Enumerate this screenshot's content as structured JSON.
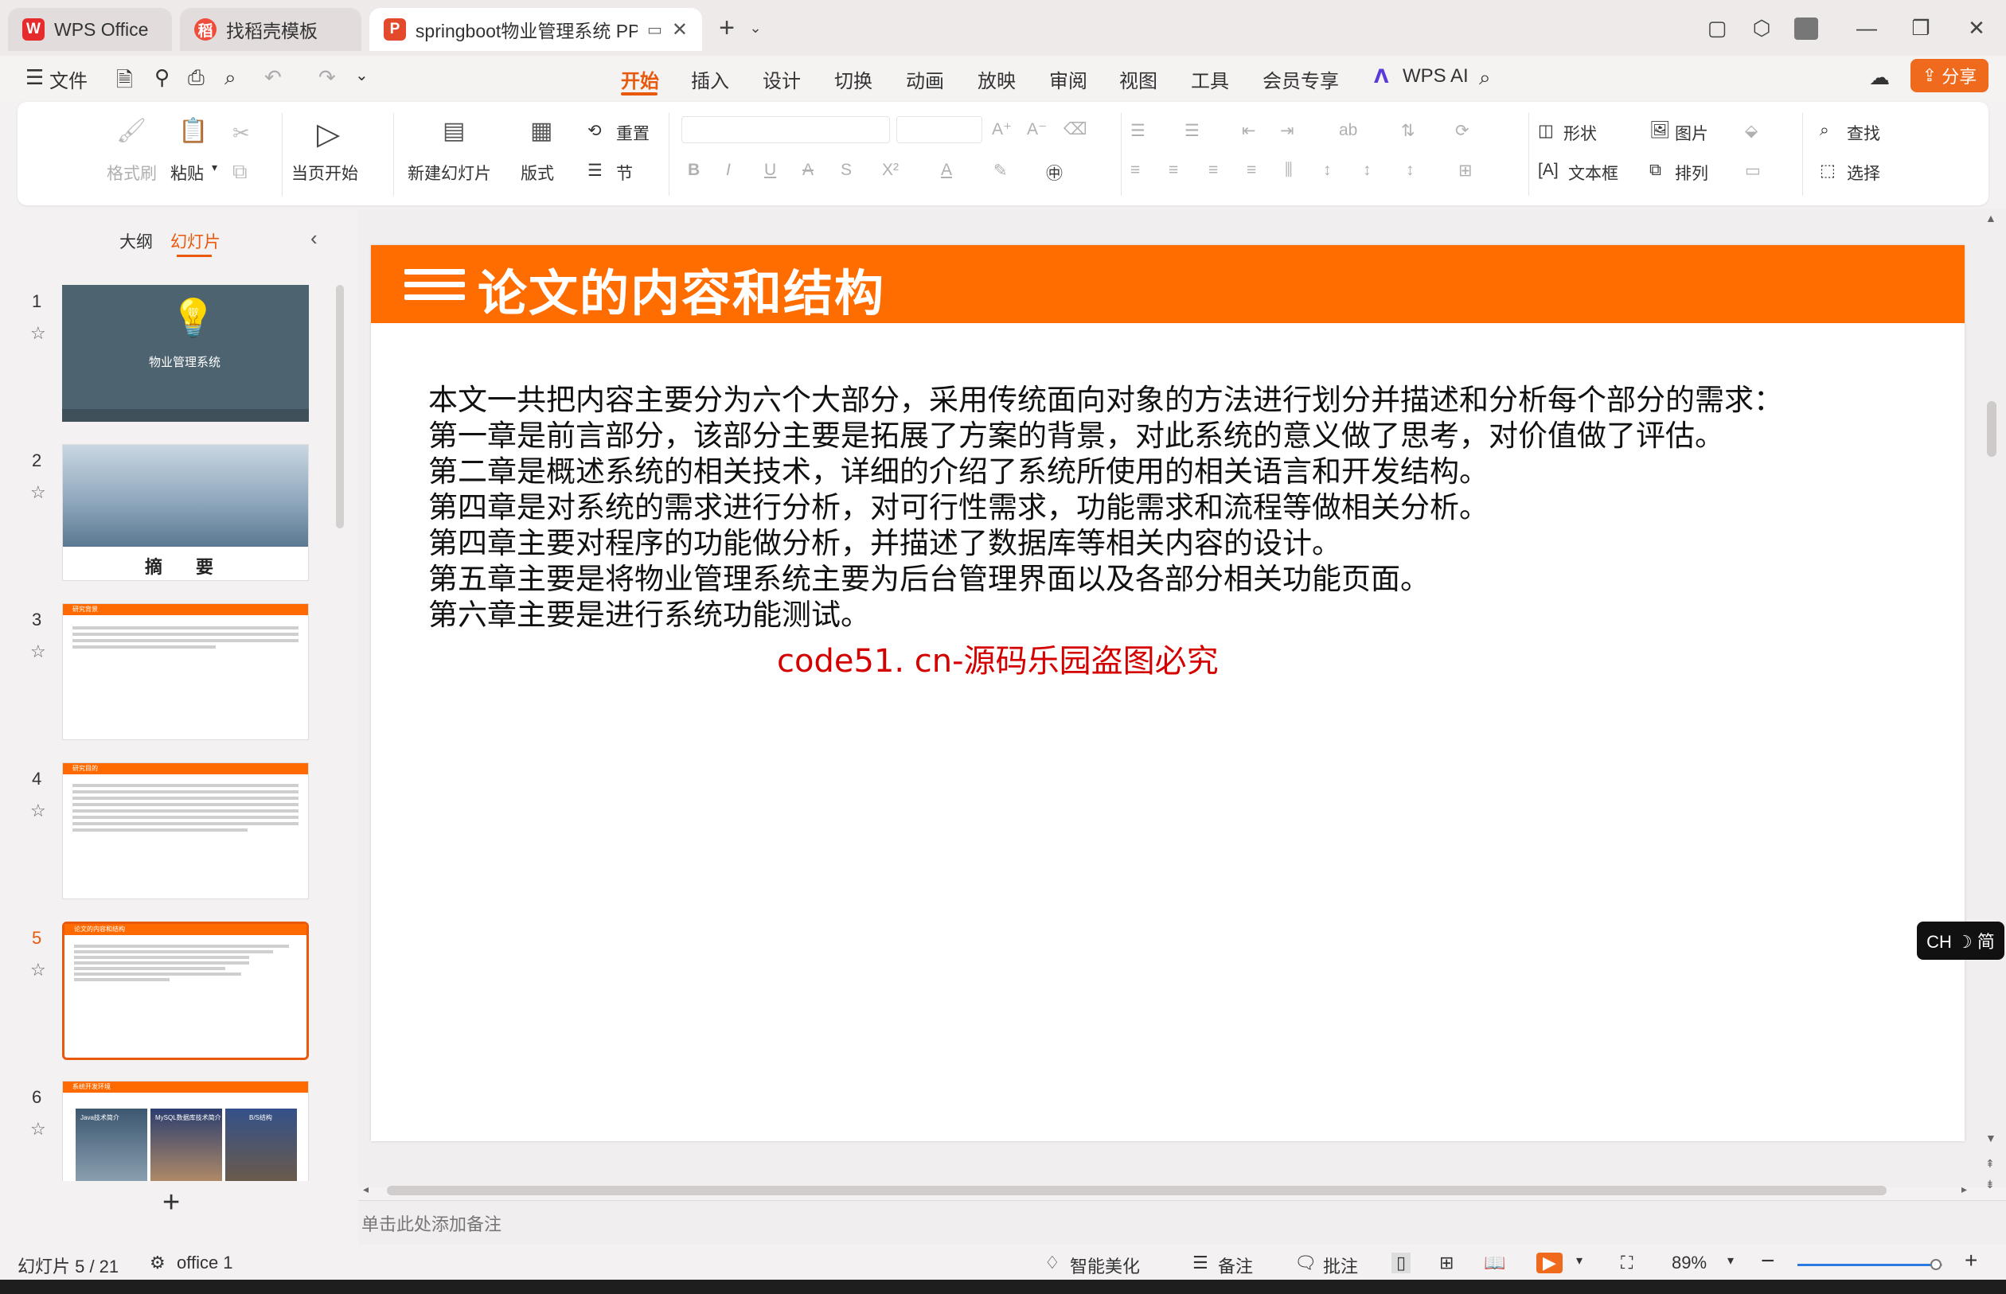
{
  "tabs": [
    {
      "label": "WPS Office",
      "badge": "W"
    },
    {
      "label": "找稻壳模板",
      "badge": "稻"
    },
    {
      "label": "springboot物业管理系统 PPT",
      "badge": "P"
    }
  ],
  "menu": {
    "file_label": "文件",
    "items": [
      "开始",
      "插入",
      "设计",
      "切换",
      "动画",
      "放映",
      "审阅",
      "视图",
      "工具",
      "会员专享"
    ],
    "active_index": 0,
    "wps_ai": "WPS AI",
    "share": "分享"
  },
  "ribbon": {
    "format_painter": "格式刷",
    "paste": "粘贴",
    "from_current": "当页开始",
    "new_slide": "新建幻灯片",
    "layout": "版式",
    "reset": "重置",
    "section": "节",
    "shape": "形状",
    "picture": "图片",
    "textbox": "文本框",
    "arrange": "排列",
    "find": "查找",
    "select": "选择"
  },
  "left_panel": {
    "tab_outline": "大纲",
    "tab_slides": "幻灯片",
    "slides": [
      {
        "num": "1",
        "title": "物业管理系统"
      },
      {
        "num": "2",
        "title": "摘 要"
      },
      {
        "num": "3",
        "title": "研究背景"
      },
      {
        "num": "4",
        "title": "研究目的"
      },
      {
        "num": "5",
        "title": "论文的内容和结构"
      },
      {
        "num": "6",
        "title": "系统开发环境",
        "cards": [
          "Java技术简介",
          "MySQL数据库技术简介",
          "B/S结构"
        ]
      }
    ],
    "selected": 5
  },
  "slide": {
    "title": "论文的内容和结构",
    "lines": [
      "本文一共把内容主要分为六个大部分，采用传统面向对象的方法进行划分并描述和分析每个部分的需求：",
      "第一章是前言部分，该部分主要是拓展了方案的背景，对此系统的意义做了思考，对价值做了评估。",
      "第二章是概述系统的相关技术，详细的介绍了系统所使用的相关语言和开发结构。",
      "第四章是对系统的需求进行分析，对可行性需求，功能需求和流程等做相关分析。",
      "第四章主要对程序的功能做分析，并描述了数据库等相关内容的设计。",
      "第五章主要是将物业管理系统主要为后台管理界面以及各部分相关功能页面。",
      "第六章主要是进行系统功能测试。"
    ],
    "watermark": "code51. cn-源码乐园盗图必究"
  },
  "notes_placeholder": "单击此处添加备注",
  "ime": "CH ☽ 简",
  "status": {
    "slide_counter": "幻灯片 5 / 21",
    "theme": "office 1",
    "beautify": "智能美化",
    "notes": "备注",
    "comment": "批注",
    "zoom": "89%",
    "zoom_fraction": 0.89
  },
  "colors": {
    "accent": "#e8590c",
    "slide_header": "#ff6d00",
    "watermark": "#d40000"
  }
}
